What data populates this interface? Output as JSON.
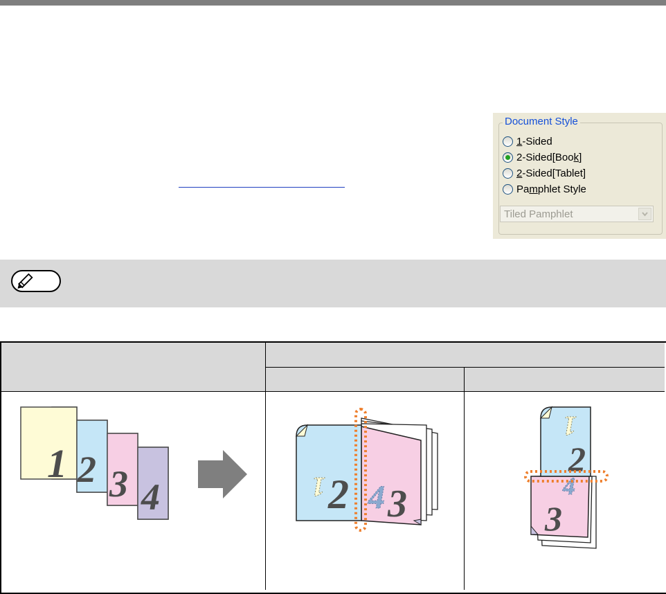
{
  "document_style": {
    "title": "Document Style",
    "options": [
      {
        "prefix": "",
        "key": "1",
        "suffix": "-Sided",
        "checked": false
      },
      {
        "prefix": "2-Sided[Boo",
        "key": "k",
        "suffix": "]",
        "checked": true
      },
      {
        "prefix": "",
        "key": "2",
        "suffix": "-Sided[Tablet]",
        "checked": false
      },
      {
        "prefix": "Pa",
        "key": "m",
        "suffix": "phlet Style",
        "checked": false
      }
    ],
    "pamphlet_select": "Tiled Pamphlet"
  },
  "illustration": {
    "page_numbers": [
      "1",
      "2",
      "3",
      "4"
    ],
    "colors": {
      "page1": "#fefbd6",
      "page2": "#c5e6f7",
      "page3": "#f7cfe4",
      "page4": "#c8c2e0",
      "binding_marker": "#ee7f2d",
      "arrow": "#7f7f7f"
    }
  }
}
